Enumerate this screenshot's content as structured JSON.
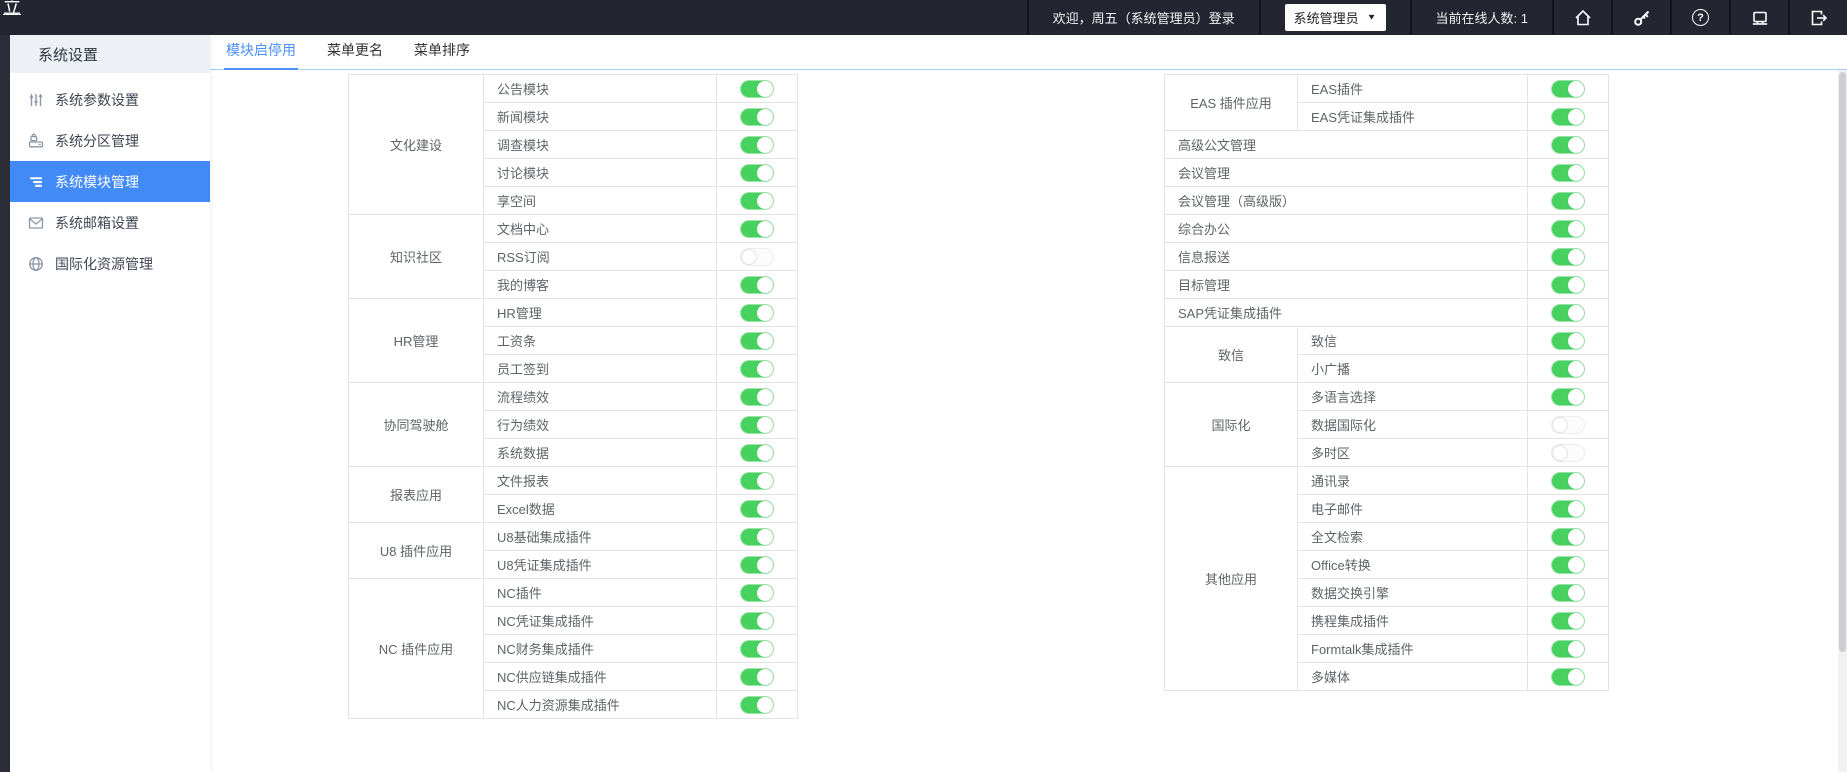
{
  "topbar": {
    "logo_text": "立",
    "welcome_text": "欢迎，周五（系统管理员）登录",
    "role_dropdown_value": "系统管理员",
    "online_text": "当前在线人数: 1"
  },
  "sidebar": {
    "title": "系统设置",
    "items": [
      {
        "label": "系统参数设置",
        "icon": "sliders-icon",
        "active": false
      },
      {
        "label": "系统分区管理",
        "icon": "partition-lock-icon",
        "active": false
      },
      {
        "label": "系统模块管理",
        "icon": "module-list-icon",
        "active": true
      },
      {
        "label": "系统邮箱设置",
        "icon": "mail-icon",
        "active": false
      },
      {
        "label": "国际化资源管理",
        "icon": "globe-icon",
        "active": false
      }
    ]
  },
  "tabs": [
    {
      "label": "模块启停用",
      "active": true
    },
    {
      "label": "菜单更名",
      "active": false
    },
    {
      "label": "菜单排序",
      "active": false
    }
  ],
  "left_table": {
    "groups": [
      {
        "name": "文化建设",
        "modules": [
          {
            "name": "公告模块",
            "on": true
          },
          {
            "name": "新闻模块",
            "on": true
          },
          {
            "name": "调查模块",
            "on": true
          },
          {
            "name": "讨论模块",
            "on": true
          },
          {
            "name": "享空间",
            "on": true
          }
        ]
      },
      {
        "name": "知识社区",
        "modules": [
          {
            "name": "文档中心",
            "on": true,
            "tall": true
          },
          {
            "name": "RSS订阅",
            "on": false
          },
          {
            "name": "我的博客",
            "on": true
          }
        ]
      },
      {
        "name": "HR管理",
        "modules": [
          {
            "name": "HR管理",
            "on": true
          },
          {
            "name": "工资条",
            "on": true
          },
          {
            "name": "员工签到",
            "on": true
          }
        ]
      },
      {
        "name": "协同驾驶舱",
        "modules": [
          {
            "name": "流程绩效",
            "on": true
          },
          {
            "name": "行为绩效",
            "on": true
          },
          {
            "name": "系统数据",
            "on": true
          }
        ]
      },
      {
        "name": "报表应用",
        "modules": [
          {
            "name": "文件报表",
            "on": true
          },
          {
            "name": "Excel数据",
            "on": true
          }
        ]
      },
      {
        "name": "U8 插件应用",
        "modules": [
          {
            "name": "U8基础集成插件",
            "on": true
          },
          {
            "name": "U8凭证集成插件",
            "on": true
          }
        ]
      },
      {
        "name": "NC 插件应用",
        "modules": [
          {
            "name": "NC插件",
            "on": true
          },
          {
            "name": "NC凭证集成插件",
            "on": true
          },
          {
            "name": "NC财务集成插件",
            "on": true
          },
          {
            "name": "NC供应链集成插件",
            "on": true
          },
          {
            "name": "NC人力资源集成插件",
            "on": true
          }
        ]
      }
    ]
  },
  "right_table": {
    "groups": [
      {
        "name": "EAS 插件应用",
        "modules": [
          {
            "name": "EAS插件",
            "on": true
          },
          {
            "name": "EAS凭证集成插件",
            "on": true
          }
        ]
      },
      {
        "name": null,
        "modules": [
          {
            "name": "高级公文管理",
            "on": true
          }
        ]
      },
      {
        "name": null,
        "modules": [
          {
            "name": "会议管理",
            "on": true
          }
        ]
      },
      {
        "name": null,
        "modules": [
          {
            "name": "会议管理（高级版）",
            "on": true
          }
        ]
      },
      {
        "name": null,
        "modules": [
          {
            "name": "综合办公",
            "on": true
          }
        ]
      },
      {
        "name": null,
        "modules": [
          {
            "name": "信息报送",
            "on": true
          }
        ]
      },
      {
        "name": null,
        "modules": [
          {
            "name": "目标管理",
            "on": true
          }
        ]
      },
      {
        "name": null,
        "modules": [
          {
            "name": "SAP凭证集成插件",
            "on": true
          }
        ]
      },
      {
        "name": "致信",
        "modules": [
          {
            "name": "致信",
            "on": true
          },
          {
            "name": "小广播",
            "on": true
          }
        ]
      },
      {
        "name": "国际化",
        "modules": [
          {
            "name": "多语言选择",
            "on": true
          },
          {
            "name": "数据国际化",
            "on": false
          },
          {
            "name": "多时区",
            "on": false
          }
        ]
      },
      {
        "name": "其他应用",
        "modules": [
          {
            "name": "通讯录",
            "on": true
          },
          {
            "name": "电子邮件",
            "on": true
          },
          {
            "name": "全文检索",
            "on": true
          },
          {
            "name": "Office转换",
            "on": true,
            "highlight": true
          },
          {
            "name": "数据交换引擎",
            "on": true
          },
          {
            "name": "携程集成插件",
            "on": true
          },
          {
            "name": "Formtalk集成插件",
            "on": true
          },
          {
            "name": "多媒体",
            "on": true
          }
        ]
      }
    ]
  },
  "colors": {
    "topbar_bg": "#232530",
    "accent_blue": "#4a90f8",
    "sidebar_active_blue": "#428bf7",
    "toggle_on_green": "#47d15f",
    "highlight_red": "#e60000"
  }
}
